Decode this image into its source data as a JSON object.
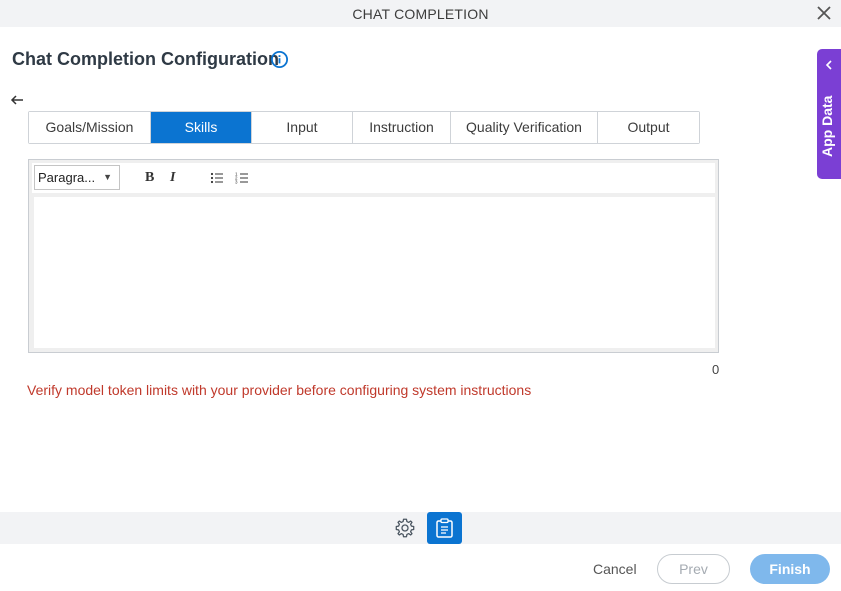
{
  "window": {
    "title": "CHAT COMPLETION"
  },
  "page": {
    "title": "Chat Completion Configuration"
  },
  "tabs": [
    {
      "label": "Goals/Mission",
      "active": false
    },
    {
      "label": "Skills",
      "active": true
    },
    {
      "label": "Input",
      "active": false
    },
    {
      "label": "Instruction",
      "active": false
    },
    {
      "label": "Quality Verification",
      "active": false
    },
    {
      "label": "Output",
      "active": false
    }
  ],
  "editor": {
    "format_select": "Paragra...",
    "bold_label": "B",
    "italic_label": "I",
    "content": "",
    "char_count": "0"
  },
  "warning": "Verify model token limits with your provider before configuring system instructions",
  "footer": {
    "cancel_label": "Cancel",
    "prev_label": "Prev",
    "finish_label": "Finish"
  },
  "side_panel": {
    "label": "App Data"
  },
  "colors": {
    "accent": "#0b74d1",
    "warning": "#c0392b",
    "side_panel": "#7b3fd4",
    "finish_disabled": "#7fb8ec"
  }
}
